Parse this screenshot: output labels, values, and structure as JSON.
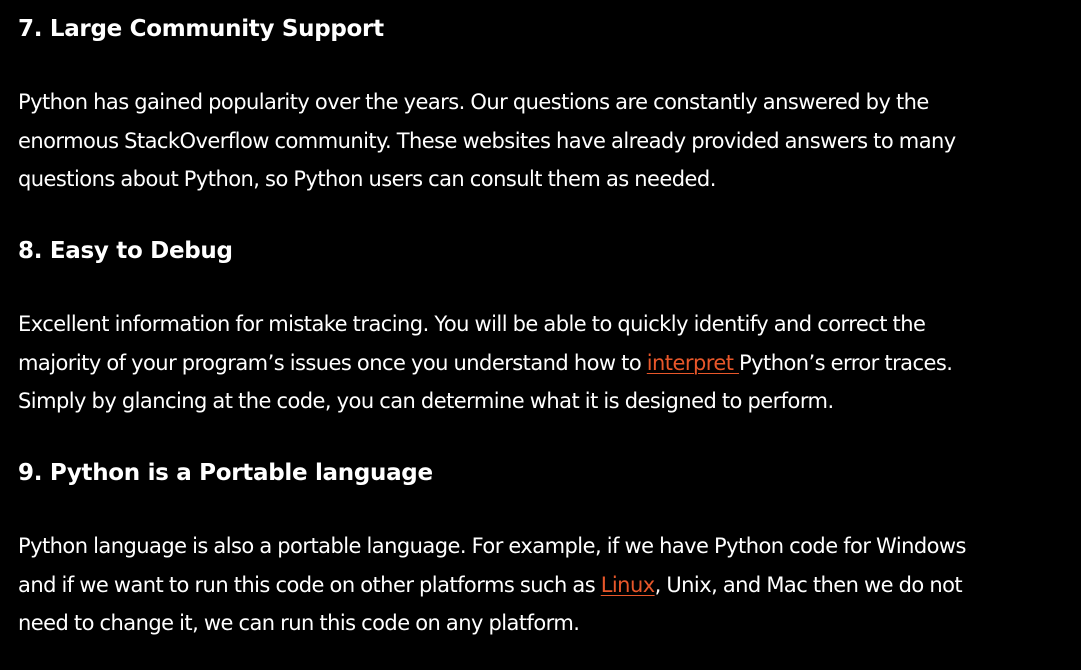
{
  "colors": {
    "background": "#000000",
    "text": "#ffffff",
    "link": "#e8572a"
  },
  "sections": [
    {
      "heading": "7. Large Community Support",
      "lines": [
        "Python has gained popularity over the years. Our questions are constantly answered by the",
        "enormous StackOverflow community. These websites have already provided answers to many",
        "questions about Python, so Python users can consult them as needed."
      ]
    },
    {
      "heading": "8. Easy to Debug",
      "line1": "Excellent information for mistake tracing. You will be able to quickly identify and correct the",
      "line2_before": "majority of your program’s issues once you understand how to ",
      "line2_link": "interpret ",
      "line2_after": "Python’s error traces.",
      "line3": "Simply by glancing at the code, you can determine what it is designed to perform."
    },
    {
      "heading": "9. Python is a Portable language",
      "line1": "Python language is also a portable language. For example, if we have Python code for Windows",
      "line2_before": "and if we want to run this code on other platforms such as ",
      "line2_link": "Linux",
      "line2_after": ", Unix, and Mac then we do not",
      "line3": "need to change it, we can run this code on any platform."
    }
  ]
}
